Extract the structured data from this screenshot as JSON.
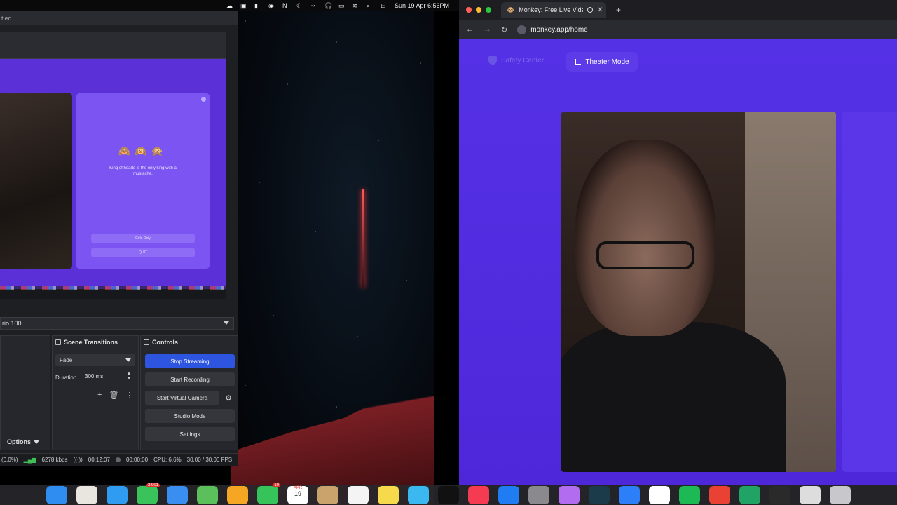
{
  "menubar": {
    "datetime": "Sun 19 Apr  6:56PM",
    "icons": [
      "creative-cloud-icon",
      "screen-share-icon",
      "battery-icon",
      "control-center-icon",
      "notion-icon",
      "do-not-disturb-icon",
      "dots-icon",
      "headphones-icon",
      "battery-full-icon",
      "wifi-icon",
      "search-icon",
      "toggle-icon"
    ]
  },
  "obs": {
    "title_fragment": "tled",
    "preview": {
      "emojis": "🙈🙉🙊",
      "joke": "King of hearts is the only king with a mustache.",
      "girls_only": "Girls Only",
      "quit": "QUIT"
    },
    "scene_select": "rio 100",
    "transitions": {
      "title": "Scene Transitions",
      "selected": "Fade",
      "duration_label": "Duration",
      "duration_value": "300 ms"
    },
    "controls": {
      "title": "Controls",
      "stop_streaming": "Stop Streaming",
      "start_recording": "Start Recording",
      "start_virtual_camera": "Start Virtual Camera",
      "studio_mode": "Studio Mode",
      "settings": "Settings"
    },
    "options_label": "Options",
    "status": {
      "dropped": "(0.0%)",
      "bitrate": "6278 kbps",
      "stream_time": "00:12:07",
      "rec_time": "00:00:00",
      "cpu": "CPU: 6.6%",
      "fps": "30.00 / 30.00 FPS"
    }
  },
  "browser": {
    "tab_title": "Monkey: Free Live Video",
    "url": "monkey.app/home",
    "safety_center": "Safety Center",
    "theater_mode": "Theater Mode"
  },
  "dock": {
    "badges": {
      "messages": "2,901",
      "reminders": "10",
      "calendar_month": "APR",
      "calendar_day": "19"
    }
  }
}
